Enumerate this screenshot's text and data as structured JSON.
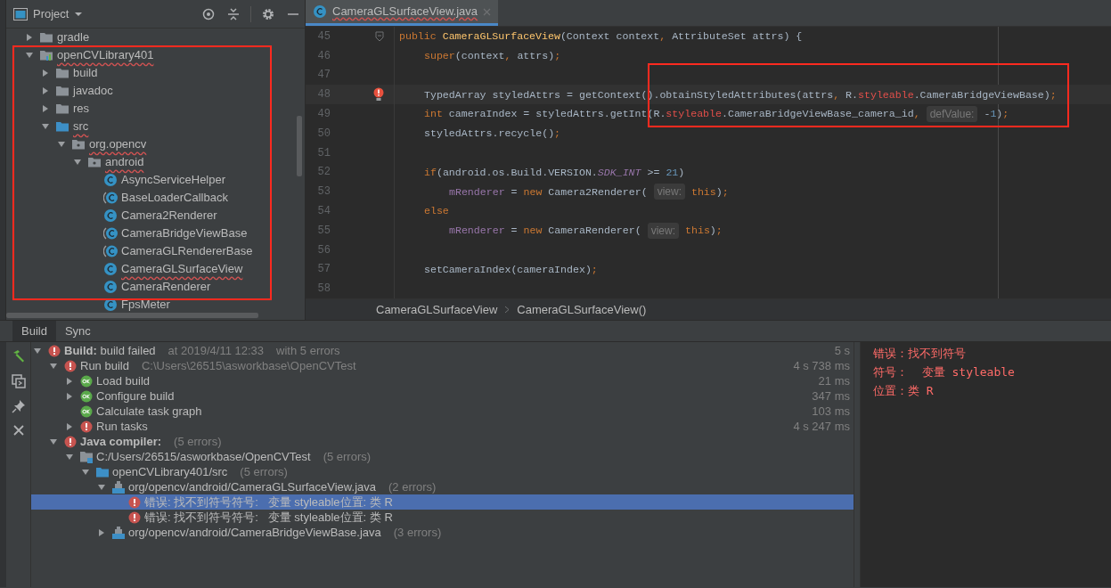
{
  "project_panel": {
    "title": "Project",
    "tree": [
      {
        "label": "gradle",
        "kind": "folder",
        "expanded": false,
        "error": false
      },
      {
        "label": "openCVLibrary401",
        "kind": "module",
        "expanded": true,
        "error": true,
        "children": [
          {
            "label": "build",
            "kind": "folder",
            "expanded": false,
            "error": false
          },
          {
            "label": "javadoc",
            "kind": "folder",
            "expanded": false,
            "error": false
          },
          {
            "label": "res",
            "kind": "folder",
            "expanded": false,
            "error": false
          },
          {
            "label": "src",
            "kind": "source_folder",
            "expanded": true,
            "error": true,
            "children": [
              {
                "label": "org.opencv",
                "kind": "package",
                "expanded": true,
                "error": true,
                "children": [
                  {
                    "label": "android",
                    "kind": "package",
                    "expanded": true,
                    "error": true,
                    "children": [
                      {
                        "label": "AsyncServiceHelper",
                        "kind": "class",
                        "error": false
                      },
                      {
                        "label": "BaseLoaderCallback",
                        "kind": "abstract_class",
                        "error": false
                      },
                      {
                        "label": "Camera2Renderer",
                        "kind": "class",
                        "error": false
                      },
                      {
                        "label": "CameraBridgeViewBase",
                        "kind": "abstract_class",
                        "error": false
                      },
                      {
                        "label": "CameraGLRendererBase",
                        "kind": "abstract_class",
                        "error": false
                      },
                      {
                        "label": "CameraGLSurfaceView",
                        "kind": "class",
                        "error": true
                      },
                      {
                        "label": "CameraRenderer",
                        "kind": "class",
                        "error": false
                      },
                      {
                        "label": "FpsMeter",
                        "kind": "class",
                        "error": false
                      }
                    ]
                  }
                ]
              }
            ]
          }
        ]
      }
    ]
  },
  "editor": {
    "tabs": [
      {
        "label": "CameraGLSurfaceView.java",
        "selected": true,
        "error": true
      }
    ],
    "lines": [
      {
        "number": "45",
        "kind": "method",
        "current": false,
        "marker": {
          "kind": "fold"
        },
        "tokens": [
          {
            "text": "public",
            "kind": "keyword"
          },
          {
            "text": " CameraGLSurfaceView",
            "kind": "decl"
          },
          {
            "text": "(Context context",
            "kind": "plain"
          },
          {
            "text": ",",
            "kind": "punct"
          },
          {
            "text": " AttributeSet attrs) {",
            "kind": "plain"
          }
        ]
      },
      {
        "number": "46",
        "kind": "body",
        "current": false,
        "tokens": [
          {
            "text": "super",
            "kind": "keyword"
          },
          {
            "text": "(context",
            "kind": "plain"
          },
          {
            "text": ",",
            "kind": "punct"
          },
          {
            "text": " attrs)",
            "kind": "plain"
          },
          {
            "text": ";",
            "kind": "punct"
          }
        ]
      },
      {
        "number": "47",
        "kind": "body",
        "current": false
      },
      {
        "number": "48",
        "kind": "body",
        "current": true,
        "marker": {
          "kind": "bulb"
        },
        "tokens": [
          {
            "text": "TypedArray styledAttrs = getContext().obtainStyledAttributes(attrs",
            "kind": "plain"
          },
          {
            "text": ",",
            "kind": "punct"
          },
          {
            "text": " R.",
            "kind": "plain"
          },
          {
            "text": "styleable",
            "kind": "error"
          },
          {
            "text": ".CameraBridgeViewBase)",
            "kind": "plain"
          },
          {
            "text": ";",
            "kind": "punct"
          }
        ]
      },
      {
        "number": "49",
        "kind": "body",
        "current": false,
        "tokens": [
          {
            "text": "int",
            "kind": "keyword"
          },
          {
            "text": " cameraIndex = styledAttrs.getInt(R.",
            "kind": "plain"
          },
          {
            "text": "styleable",
            "kind": "error"
          },
          {
            "text": ".CameraBridgeViewBase_camera_id",
            "kind": "plain"
          },
          {
            "text": ",",
            "kind": "punct"
          },
          {
            "text": "defValue:",
            "kind": "hint"
          },
          {
            "text": " -",
            "kind": "plain"
          },
          {
            "text": "1",
            "kind": "number"
          },
          {
            "text": ")",
            "kind": "plain"
          },
          {
            "text": ";",
            "kind": "punct"
          }
        ]
      },
      {
        "number": "50",
        "kind": "body",
        "current": false,
        "tokens": [
          {
            "text": "styledAttrs.recycle()",
            "kind": "plain"
          },
          {
            "text": ";",
            "kind": "punct"
          }
        ]
      },
      {
        "number": "51",
        "kind": "body",
        "current": false
      },
      {
        "number": "52",
        "kind": "body",
        "current": false,
        "tokens": [
          {
            "text": "if",
            "kind": "keyword"
          },
          {
            "text": "(android.os.Build.VERSION.",
            "kind": "plain"
          },
          {
            "text": "SDK_INT",
            "kind": "static"
          },
          {
            "text": " >= ",
            "kind": "plain"
          },
          {
            "text": "21",
            "kind": "number"
          },
          {
            "text": ")",
            "kind": "plain"
          }
        ]
      },
      {
        "number": "53",
        "kind": "nested",
        "current": false,
        "tokens": [
          {
            "text": "mRenderer",
            "kind": "field"
          },
          {
            "text": " = ",
            "kind": "plain"
          },
          {
            "text": "new",
            "kind": "keyword"
          },
          {
            "text": " Camera2Renderer(",
            "kind": "plain"
          },
          {
            "text": "view:",
            "kind": "hint"
          },
          {
            "text": " this",
            "kind": "keyword"
          },
          {
            "text": ")",
            "kind": "plain"
          },
          {
            "text": ";",
            "kind": "punct"
          }
        ]
      },
      {
        "number": "54",
        "kind": "body",
        "current": false,
        "tokens": [
          {
            "text": "else",
            "kind": "keyword"
          }
        ]
      },
      {
        "number": "55",
        "kind": "nested",
        "current": false,
        "tokens": [
          {
            "text": "mRenderer",
            "kind": "field"
          },
          {
            "text": " = ",
            "kind": "plain"
          },
          {
            "text": "new",
            "kind": "keyword"
          },
          {
            "text": " CameraRenderer(",
            "kind": "plain"
          },
          {
            "text": "view:",
            "kind": "hint"
          },
          {
            "text": " this",
            "kind": "keyword"
          },
          {
            "text": ")",
            "kind": "plain"
          },
          {
            "text": ";",
            "kind": "punct"
          }
        ]
      },
      {
        "number": "56",
        "kind": "body",
        "current": false
      },
      {
        "number": "57",
        "kind": "body",
        "current": false,
        "tokens": [
          {
            "text": "setCameraIndex(cameraIndex)",
            "kind": "plain"
          },
          {
            "text": ";",
            "kind": "punct"
          }
        ]
      },
      {
        "number": "58",
        "kind": "body",
        "current": false
      }
    ],
    "breadcrumbs": [
      "CameraGLSurfaceView",
      "CameraGLSurfaceView()"
    ]
  },
  "bottom_panel": {
    "tabs": [
      {
        "label": "Build",
        "selected": true
      },
      {
        "label": "Sync",
        "selected": false
      }
    ],
    "build_tree": [
      {
        "label": "**Build:** build failed",
        "kind": "error",
        "expanded": true,
        "selected": false,
        "details": [
          "at 2019/4/11 12:33",
          "with 5 errors"
        ],
        "time": "5 s",
        "children": [
          {
            "label": "Run build",
            "kind": "error",
            "expanded": true,
            "selected": false,
            "details": [
              "C:\\Users\\26515\\asworkbase\\OpenCVTest"
            ],
            "time": "4 s 738 ms",
            "children": [
              {
                "label": "Load build",
                "kind": "ok",
                "expanded": false,
                "selected": false,
                "time": "21 ms"
              },
              {
                "label": "Configure build",
                "kind": "ok",
                "expanded": false,
                "selected": false,
                "time": "347 ms"
              },
              {
                "label": "Calculate task graph",
                "kind": "ok",
                "selected": false,
                "time": "103 ms"
              },
              {
                "label": "Run tasks",
                "kind": "error",
                "expanded": false,
                "selected": false,
                "time": "4 s 247 ms"
              }
            ]
          },
          {
            "label": "Java compiler:",
            "bold": true,
            "kind": "error",
            "expanded": true,
            "selected": false,
            "details": [
              "(5 errors)"
            ],
            "children": [
              {
                "label": "C:/Users/26515/asworkbase/OpenCVTest",
                "kind": "project",
                "expanded": true,
                "selected": false,
                "details": [
                  "(5 errors)"
                ],
                "children": [
                  {
                    "label": "openCVLibrary401/src",
                    "kind": "folder",
                    "expanded": true,
                    "selected": false,
                    "details": [
                      "(5 errors)"
                    ],
                    "children": [
                      {
                        "label": "org/opencv/android/CameraGLSurfaceView.java",
                        "kind": "java_file",
                        "expanded": true,
                        "selected": false,
                        "details": [
                          "(2 errors)"
                        ],
                        "children": [
                          {
                            "label": "错误: 找不到符号符号:   变量 styleable位置: 类 R",
                            "kind": "error",
                            "selected": true
                          },
                          {
                            "label": "错误: 找不到符号符号:   变量 styleable位置: 类 R",
                            "kind": "error",
                            "selected": false
                          }
                        ]
                      },
                      {
                        "label": "org/opencv/android/CameraBridgeViewBase.java",
                        "kind": "java_file",
                        "expanded": false,
                        "selected": false,
                        "details": [
                          "(3 errors)"
                        ]
                      }
                    ]
                  }
                ]
              }
            ]
          }
        ]
      }
    ],
    "message": [
      "错误：找不到符号",
      "符号：  变量 styleable",
      "位置：类 R"
    ]
  }
}
